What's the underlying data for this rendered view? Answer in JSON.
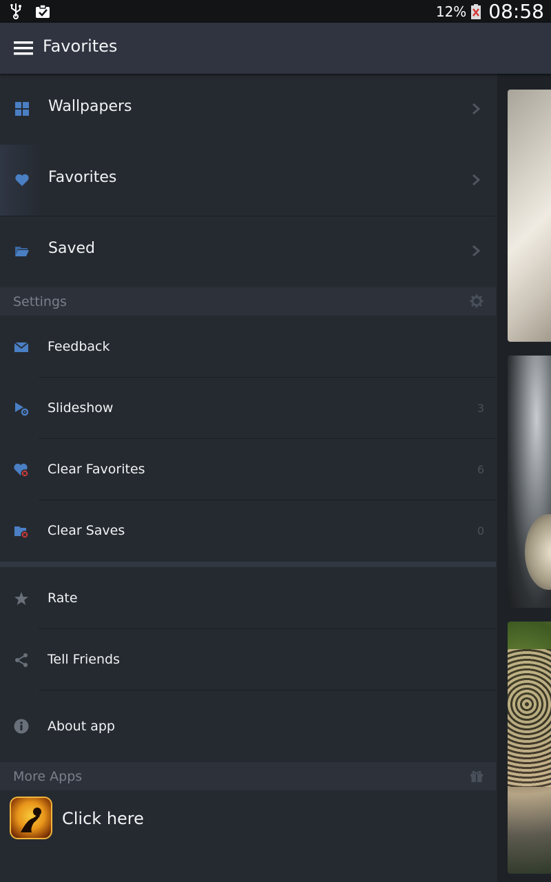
{
  "status_bar": {
    "battery_percent": "12%",
    "time": "08:58",
    "icons": [
      "usb-icon",
      "clipboard-check-icon",
      "battery-low-icon"
    ]
  },
  "app_bar": {
    "title": "Favorites",
    "menu_icon": "hamburger-menu-icon"
  },
  "nav": [
    {
      "label": "Wallpapers",
      "icon": "grid-icon"
    },
    {
      "label": "Favorites",
      "icon": "heart-icon"
    },
    {
      "label": "Saved",
      "icon": "folder-icon"
    }
  ],
  "settings": {
    "header": "Settings",
    "header_icon": "gear-icon",
    "items": [
      {
        "label": "Feedback",
        "icon": "envelope-icon",
        "count": ""
      },
      {
        "label": "Slideshow",
        "icon": "slideshow-settings-icon",
        "count": "3"
      },
      {
        "label": "Clear Favorites",
        "icon": "heart-remove-icon",
        "count": "6"
      },
      {
        "label": "Clear Saves",
        "icon": "folder-remove-icon",
        "count": "0"
      }
    ]
  },
  "misc": [
    {
      "label": "Rate",
      "icon": "star-icon"
    },
    {
      "label": "Tell Friends",
      "icon": "share-icon"
    },
    {
      "label": "About app",
      "icon": "info-icon"
    }
  ],
  "more_apps": {
    "header": "More Apps",
    "header_icon": "gift-icon",
    "promo_label": "Click here",
    "promo_icon": "app-icon"
  },
  "colors": {
    "accent": "#4a7fc4",
    "drawer_bg": "#252a31",
    "appbar_bg": "#2f3440",
    "remove_red": "#d23b3b"
  }
}
